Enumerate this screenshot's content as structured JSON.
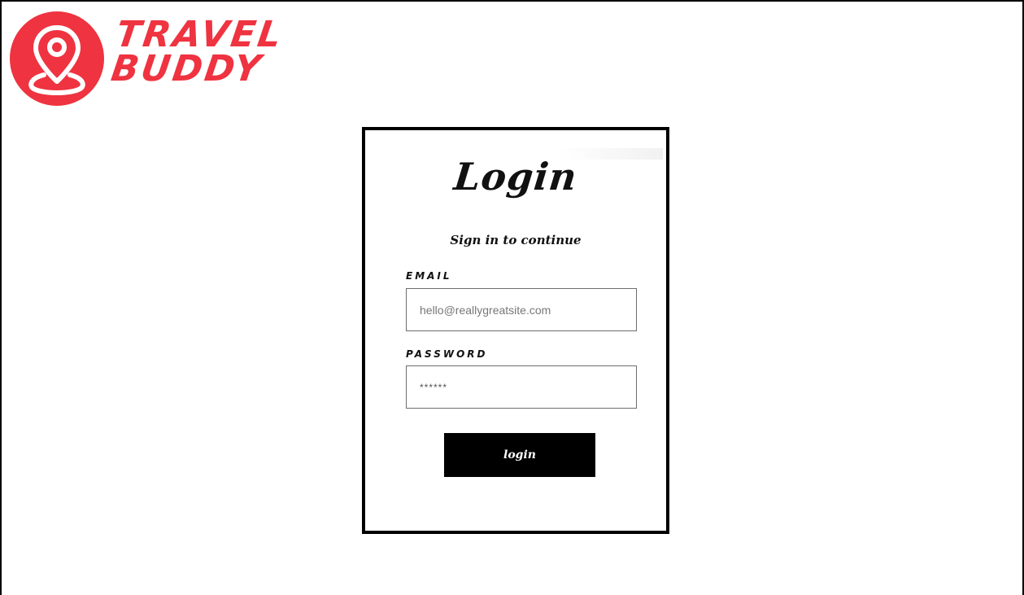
{
  "brand": {
    "line1": "TRAVEL",
    "line2": "BUDDY",
    "logo_icon": "map-pin-icon",
    "brand_color": "#ef3340"
  },
  "login": {
    "title": "Login",
    "subtitle": "Sign in to continue",
    "email_label": "EMAIL",
    "email_placeholder": "hello@reallygreatsite.com",
    "password_label": "PASSWORD",
    "password_value": "******",
    "button_label": "login"
  }
}
